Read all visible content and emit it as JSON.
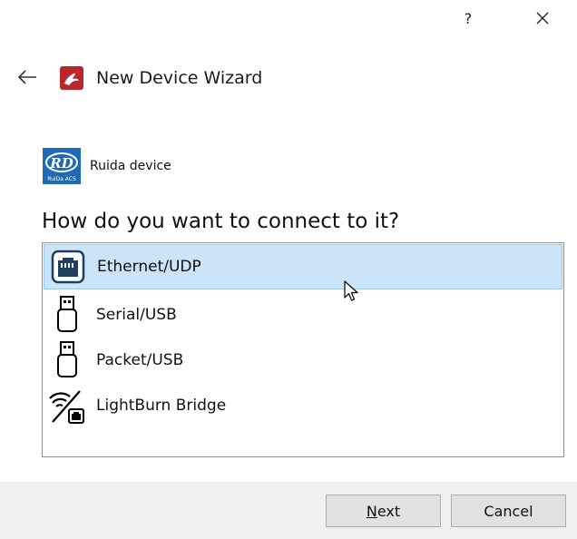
{
  "window": {
    "help_label": "?",
    "close_label": "✕"
  },
  "header": {
    "back_icon": "arrow-left-icon",
    "title": "New Device Wizard"
  },
  "device": {
    "logo_letters": "RD",
    "logo_subtext": "RuiDa ACS",
    "name": "Ruida device"
  },
  "question": "How do you want to connect to it?",
  "connections": [
    {
      "label": "Ethernet/UDP",
      "icon": "ethernet-port-icon",
      "selected": true
    },
    {
      "label": "Serial/USB",
      "icon": "usb-plug-icon",
      "selected": false
    },
    {
      "label": "Packet/USB",
      "icon": "usb-plug-icon",
      "selected": false
    },
    {
      "label": "LightBurn Bridge",
      "icon": "wifi-bridge-icon",
      "selected": false
    }
  ],
  "footer": {
    "next_mnemonic": "N",
    "next_rest": "ext",
    "cancel_label": "Cancel"
  },
  "colors": {
    "selection_bg": "#cce4f7",
    "selection_border": "#99c9ef",
    "footer_bg": "#f0f0f0",
    "ethernet_icon": "#1f3f60",
    "ruida_blue": "#1f6ab4"
  }
}
